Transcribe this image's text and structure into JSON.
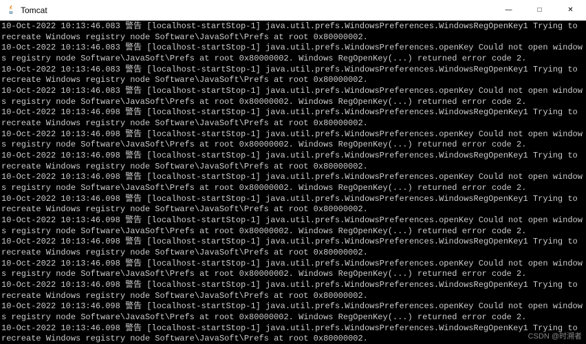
{
  "window": {
    "title": "Tomcat",
    "icon_name": "java-icon"
  },
  "controls": {
    "minimize": "—",
    "maximize": "□",
    "close": "✕"
  },
  "watermark": "CSDN @时溯者",
  "log": {
    "lines": [
      "10-Oct-2022 10:13:46.083 警告 [localhost-startStop-1] java.util.prefs.WindowsPreferences.WindowsRegOpenKey1 Trying to recreate Windows registry node Software\\JavaSoft\\Prefs at root 0x80000002.",
      "10-Oct-2022 10:13:46.083 警告 [localhost-startStop-1] java.util.prefs.WindowsPreferences.openKey Could not open windows registry node Software\\JavaSoft\\Prefs at root 0x80000002. Windows RegOpenKey(...) returned error code 2.",
      "10-Oct-2022 10:13:46.083 警告 [localhost-startStop-1] java.util.prefs.WindowsPreferences.WindowsRegOpenKey1 Trying to recreate Windows registry node Software\\JavaSoft\\Prefs at root 0x80000002.",
      "10-Oct-2022 10:13:46.083 警告 [localhost-startStop-1] java.util.prefs.WindowsPreferences.openKey Could not open windows registry node Software\\JavaSoft\\Prefs at root 0x80000002. Windows RegOpenKey(...) returned error code 2.",
      "10-Oct-2022 10:13:46.098 警告 [localhost-startStop-1] java.util.prefs.WindowsPreferences.WindowsRegOpenKey1 Trying to recreate Windows registry node Software\\JavaSoft\\Prefs at root 0x80000002.",
      "10-Oct-2022 10:13:46.098 警告 [localhost-startStop-1] java.util.prefs.WindowsPreferences.openKey Could not open windows registry node Software\\JavaSoft\\Prefs at root 0x80000002. Windows RegOpenKey(...) returned error code 2.",
      "10-Oct-2022 10:13:46.098 警告 [localhost-startStop-1] java.util.prefs.WindowsPreferences.WindowsRegOpenKey1 Trying to recreate Windows registry node Software\\JavaSoft\\Prefs at root 0x80000002.",
      "10-Oct-2022 10:13:46.098 警告 [localhost-startStop-1] java.util.prefs.WindowsPreferences.openKey Could not open windows registry node Software\\JavaSoft\\Prefs at root 0x80000002. Windows RegOpenKey(...) returned error code 2.",
      "10-Oct-2022 10:13:46.098 警告 [localhost-startStop-1] java.util.prefs.WindowsPreferences.WindowsRegOpenKey1 Trying to recreate Windows registry node Software\\JavaSoft\\Prefs at root 0x80000002.",
      "10-Oct-2022 10:13:46.098 警告 [localhost-startStop-1] java.util.prefs.WindowsPreferences.openKey Could not open windows registry node Software\\JavaSoft\\Prefs at root 0x80000002. Windows RegOpenKey(...) returned error code 2.",
      "10-Oct-2022 10:13:46.098 警告 [localhost-startStop-1] java.util.prefs.WindowsPreferences.WindowsRegOpenKey1 Trying to recreate Windows registry node Software\\JavaSoft\\Prefs at root 0x80000002.",
      "10-Oct-2022 10:13:46.098 警告 [localhost-startStop-1] java.util.prefs.WindowsPreferences.openKey Could not open windows registry node Software\\JavaSoft\\Prefs at root 0x80000002. Windows RegOpenKey(...) returned error code 2.",
      "10-Oct-2022 10:13:46.098 警告 [localhost-startStop-1] java.util.prefs.WindowsPreferences.WindowsRegOpenKey1 Trying to recreate Windows registry node Software\\JavaSoft\\Prefs at root 0x80000002.",
      "10-Oct-2022 10:13:46.098 警告 [localhost-startStop-1] java.util.prefs.WindowsPreferences.openKey Could not open windows registry node Software\\JavaSoft\\Prefs at root 0x80000002. Windows RegOpenKey(...) returned error code 2.",
      "10-Oct-2022 10:13:46.098 警告 [localhost-startStop-1] java.util.prefs.WindowsPreferences.WindowsRegOpenKey1 Trying to recreate Windows registry node Software\\JavaSoft\\Prefs at root 0x80000002."
    ]
  }
}
